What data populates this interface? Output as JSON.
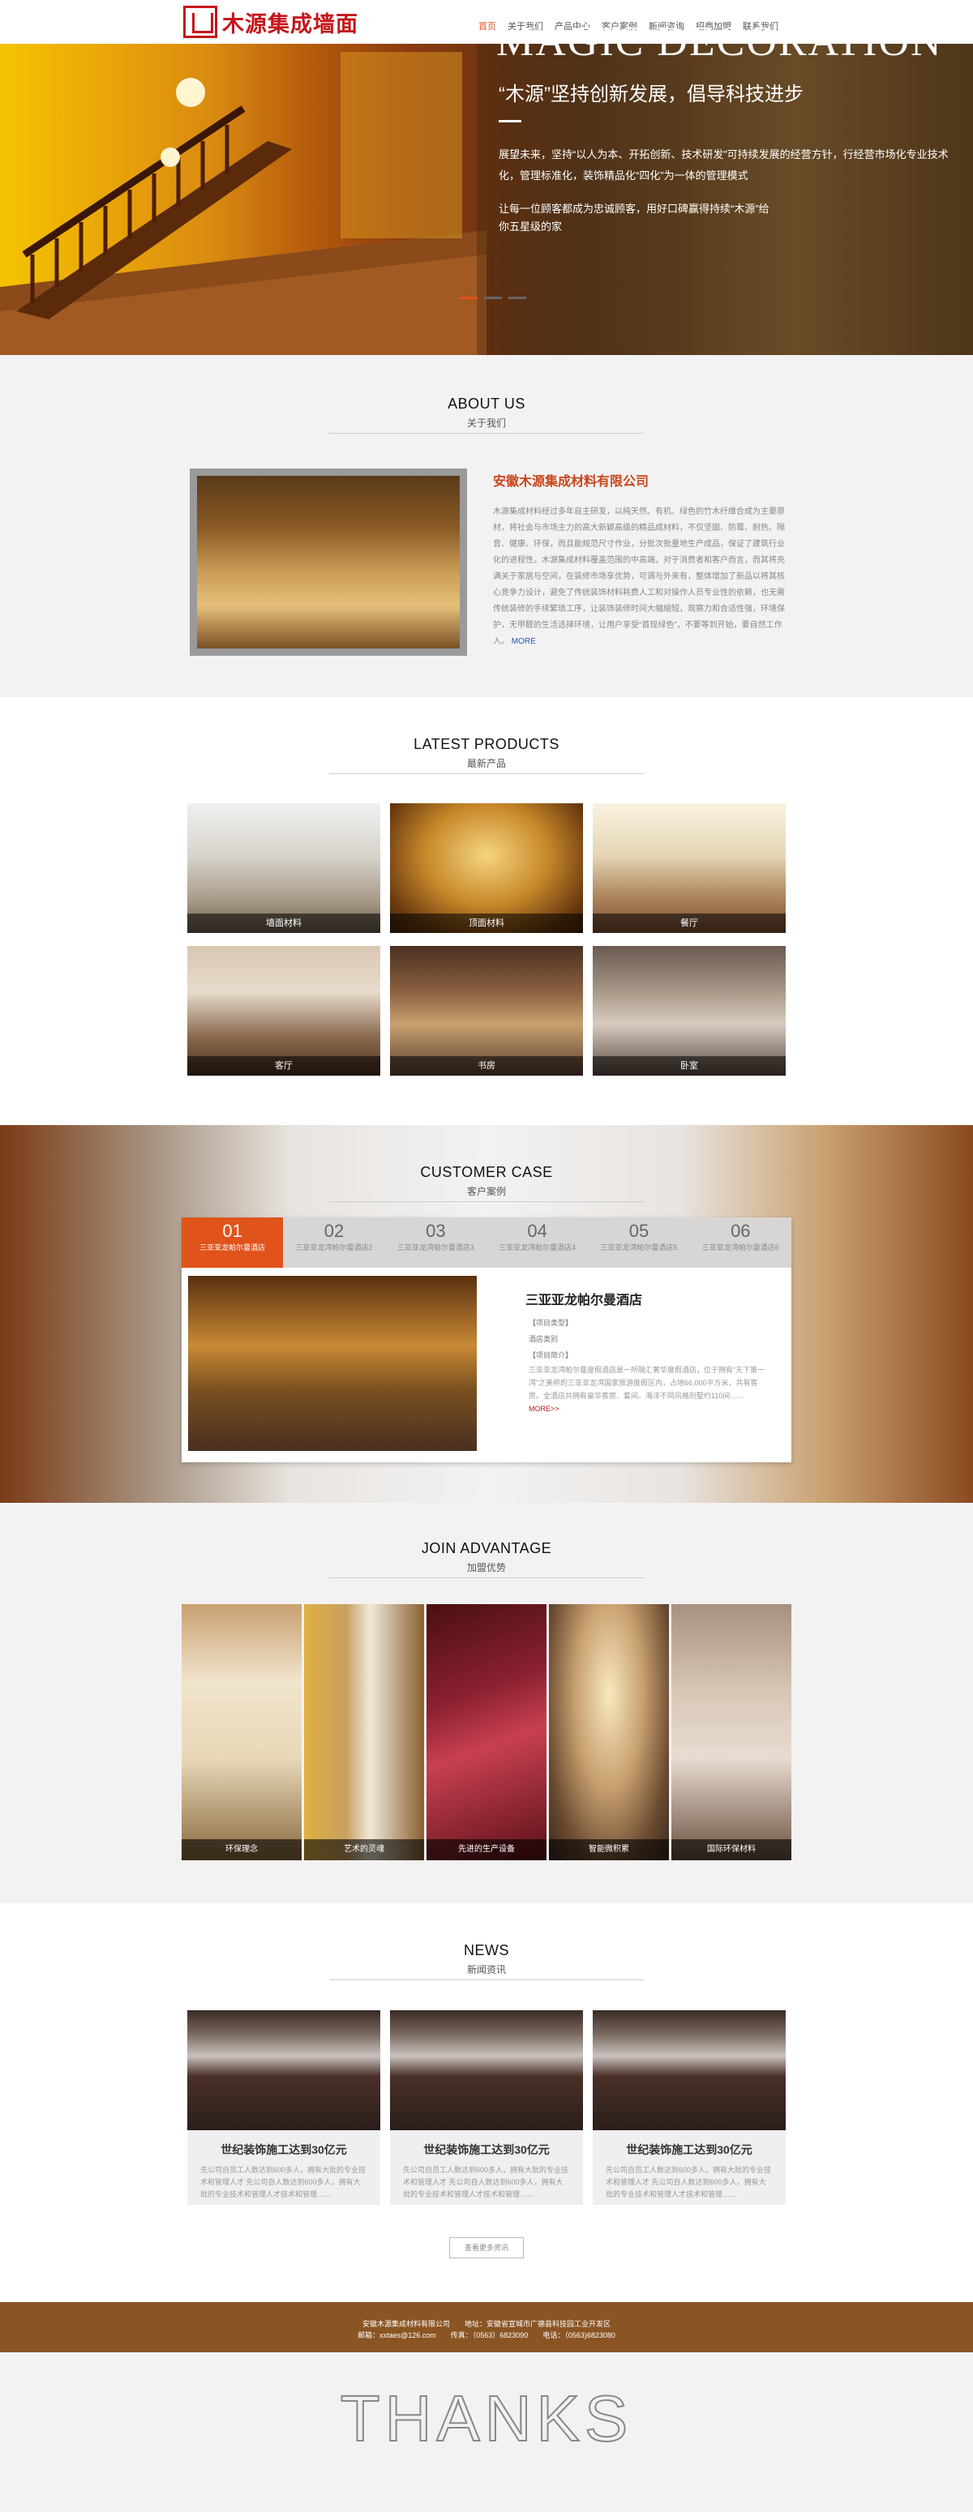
{
  "header": {
    "logo_text": "木源集成墙面"
  },
  "nav": [
    {
      "label": "首页",
      "active": true
    },
    {
      "label": "关于我们"
    },
    {
      "label": "产品中心"
    },
    {
      "label": "客户案例"
    },
    {
      "label": "新闻咨询"
    },
    {
      "label": "招商加盟"
    },
    {
      "label": "联系我们"
    }
  ],
  "banner": {
    "title": "MAGIC DECORATION",
    "slogan": "“木源”坚持创新发展，倡导科技进步",
    "p1": "展望未来，坚持“以人为本、开拓创新、技术研发”可持续发展的经营方针，行经营市场化专业技术化，管理标准化，装饰精品化“四化”为一体的管理模式",
    "p2": "让每一位顾客都成为忠诚顾客，用好口碑赢得持续“木源”给你五星级的家"
  },
  "about": {
    "en": "ABOUT US",
    "cn": "关于我们",
    "company": "安徽木源集成材料有限公司",
    "text": "木源集成材料经过多年自主研发，以纯天然、有机、绿色的竹木纤维合成为主要原材，将社会与市场主力的高大新颖高级的精品成材料，不仅坚固、防霉、耐热、隔音、健康、环保，而且能规范尺寸作业，分批次批量地生产成品，保证了建筑行业化的进程性。木源集成材料覆盖范围的中高端，对于消费者和客户而言，而其将充满关于家居与空间，在装修市场享优势，可调与外来有，整体增加了新品以将其核心竞争力设计，避免了传统装饰材料耗费人工和对操作人员专业性的依赖，也无需传统装修的手续繁琐工序，让装饰装修时间大幅缩短，观察力和合适性强，环境保护，无甲醛的生活选择环境，让用户享受“首现绿色”，不要等到开始，要自然工作入。",
    "more": "MORE"
  },
  "products": {
    "en": "LATEST PRODUCTS",
    "cn": "最新产品",
    "items": [
      {
        "label": "墙面材料"
      },
      {
        "label": "顶面材料"
      },
      {
        "label": "餐厅"
      },
      {
        "label": "客厅"
      },
      {
        "label": "书房"
      },
      {
        "label": "卧室"
      }
    ]
  },
  "case": {
    "en": "CUSTOMER CASE",
    "cn": "客户案例",
    "tabs": [
      {
        "n": "01",
        "t": "三亚亚龙帕尔曼酒店"
      },
      {
        "n": "02",
        "t": "三亚亚龙湾帕尔曼酒店2"
      },
      {
        "n": "03",
        "t": "三亚亚龙湾帕尔曼酒店3"
      },
      {
        "n": "04",
        "t": "三亚亚龙湾帕尔曼酒店4"
      },
      {
        "n": "05",
        "t": "三亚亚龙湾帕尔曼酒店5"
      },
      {
        "n": "06",
        "t": "三亚亚龙湾帕尔曼酒店6"
      }
    ],
    "name": "三亚亚龙帕尔曼酒店",
    "meta1": "【项目类型】",
    "meta2": "酒店类别",
    "meta3": "【项目简介】",
    "desc": "三亚亚龙湾帕尔曼度假酒店是一所融汇奢华度假酒店，位于拥有“天下第一湾”之美称的三亚亚龙湾国家旅游度假区内，占地66,000平方米，共有客房。全酒店共拥有豪华客房、套间、海洋不同风格别墅约110间……",
    "more": "MORE>>"
  },
  "join": {
    "en": "JOIN ADVANTAGE",
    "cn": "加盟优势",
    "items": [
      {
        "label": "环保理念"
      },
      {
        "label": "艺术的灵魂"
      },
      {
        "label": "先进的生产设备"
      },
      {
        "label": "智能微积累"
      },
      {
        "label": "国际环保材料"
      }
    ]
  },
  "news": {
    "en": "NEWS",
    "cn": "新闻资讯",
    "items": [
      {
        "title": "世纪装饰施工达到30亿元",
        "text": "先公司自员工人数达到600多人，拥有大批的专业技术和管理人才 先公司自人数达到600多人，拥有大批的专业技术和管理人才技术和管理……"
      },
      {
        "title": "世纪装饰施工达到30亿元",
        "text": "先公司自员工人数达到600多人，拥有大批的专业技术和管理人才 先公司自人数达到600多人，拥有大批的专业技术和管理人才技术和管理……"
      },
      {
        "title": "世纪装饰施工达到30亿元",
        "text": "先公司自员工人数达到600多人，拥有大批的专业技术和管理人才 先公司自人数达到600多人，拥有大批的专业技术和管理人才技术和管理……"
      }
    ],
    "more": "查看更多资讯"
  },
  "footer": {
    "line1": "安徽木源集成材料有限公司　　地址：安徽省宣城市广德县科技园工业开发区",
    "line2": "邮箱：xxtaes@126.com　　传真：（0563）6823090　　电话：（0563)6823080"
  },
  "thanks": "THANKS"
}
